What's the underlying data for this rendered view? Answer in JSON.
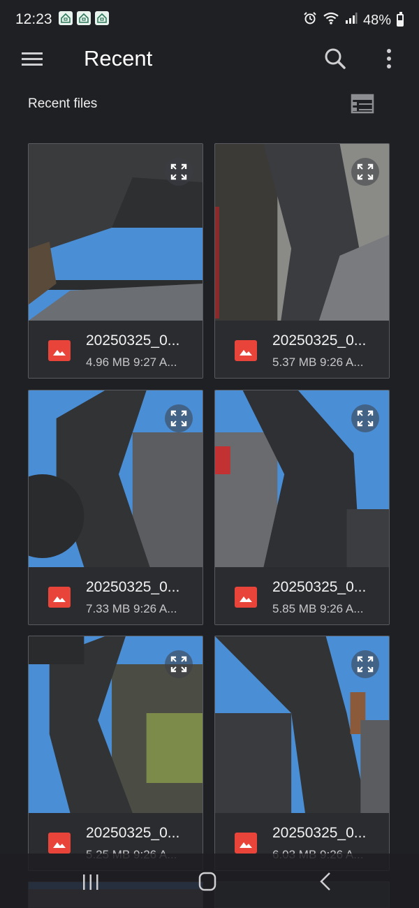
{
  "status_bar": {
    "time": "12:23",
    "battery": "48%",
    "notification_icons": [
      "home-notification-icon",
      "home-notification-icon",
      "home-notification-icon"
    ],
    "status_icons": [
      "alarm-icon",
      "wifi-icon",
      "signal-icon",
      "battery-icon"
    ]
  },
  "app_bar": {
    "title": "Recent",
    "icons": [
      "menu-icon",
      "search-icon",
      "more-vert-icon"
    ]
  },
  "section": {
    "title": "Recent files",
    "view_toggle_icon": "list-view-icon"
  },
  "files": [
    {
      "name": "20250325_0...",
      "meta": "4.96 MB 9:27 A..."
    },
    {
      "name": "20250325_0...",
      "meta": "5.37 MB 9:26 A..."
    },
    {
      "name": "20250325_0...",
      "meta": "7.33 MB 9:26 A..."
    },
    {
      "name": "20250325_0...",
      "meta": "5.85 MB 9:26 A..."
    },
    {
      "name": "20250325_0...",
      "meta": "5.25 MB 9:26 A..."
    },
    {
      "name": "20250325_0...",
      "meta": "6.03 MB 9:26 A..."
    }
  ],
  "file_type_icon": "image-file-icon",
  "nav_bar": {
    "icons": [
      "recents-icon",
      "home-icon",
      "back-icon"
    ]
  },
  "colors": {
    "background": "#1f2023",
    "card": "#2b2c30",
    "file_icon_red": "#e8443a",
    "sky": "#4a8ed6",
    "metal": "#2f3033"
  }
}
